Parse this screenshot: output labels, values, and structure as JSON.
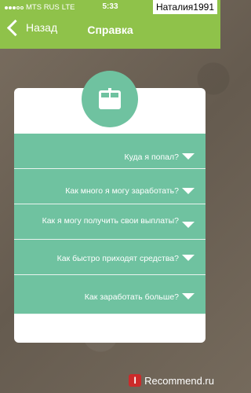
{
  "status_bar": {
    "carrier": "MTS RUS",
    "network": "LTE",
    "time": "5:33"
  },
  "watermark_user": "Наталия1991",
  "nav": {
    "back_label": "Назад",
    "title": "Справка"
  },
  "icons": {
    "back": "chevron-left-icon",
    "badge": "calendar-icon",
    "expand": "chevron-down-icon"
  },
  "faq": [
    {
      "question": "Куда я попал?"
    },
    {
      "question": "Как много я могу заработать?"
    },
    {
      "question": "Как я могу получить свои выплаты?"
    },
    {
      "question": "Как быстро приходят средства?"
    },
    {
      "question": "Как заработать больше?"
    }
  ],
  "watermark": {
    "logo_letter": "I",
    "text": "Recommend.ru"
  },
  "colors": {
    "header": "#8fc24a",
    "accent": "#6fc2a0",
    "card": "#ffffff"
  }
}
